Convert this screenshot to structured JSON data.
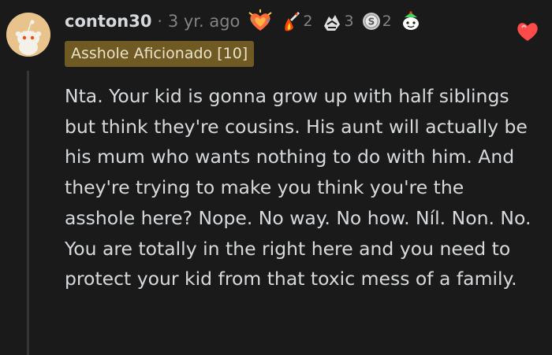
{
  "comment": {
    "username": "conton30",
    "separator": "·",
    "timestamp": "3 yr. ago",
    "awards": [
      {
        "icon": "wholesome-heart-award-icon",
        "count": ""
      },
      {
        "icon": "fire-rocket-award-icon",
        "count": "2"
      },
      {
        "icon": "hug-award-icon",
        "count": "3"
      },
      {
        "icon": "silver-award-icon",
        "count": "2"
      },
      {
        "icon": "snoo-award-icon",
        "count": ""
      }
    ],
    "flair": "Asshole Aficionado [10]",
    "reaction_icon": "heart-eyes-icon",
    "body": "Nta. Your kid is gonna grow up with half siblings but think they're cousins. His aunt will actually be his mum who wants nothing to do with him. And they're trying to make you think you're the asshole here? Nope. No way. No how. Níl. Non. No. You are totally in the right here and you need to protect your kid from that toxic mess of a family."
  },
  "colors": {
    "background": "#1a1a1b",
    "text": "#d7dadc",
    "muted": "#818384",
    "flair_bg": "#6e5a22",
    "avatar_bg": "#e8c48c"
  }
}
